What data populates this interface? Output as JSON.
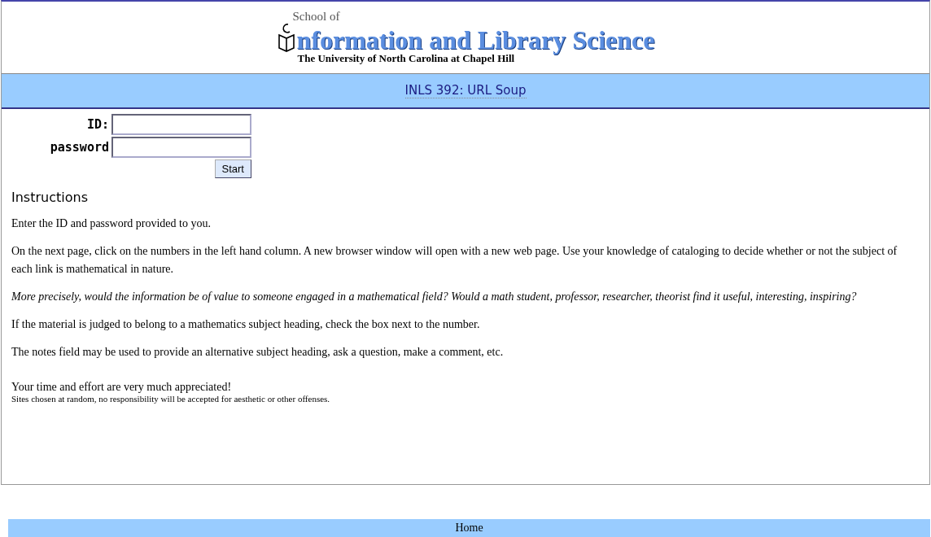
{
  "header": {
    "school_of": "School of",
    "school_name": "nformation and Library Science",
    "university": "The University of North Carolina at Chapel Hill"
  },
  "title_bar": {
    "title": "INLS 392: URL Soup"
  },
  "login": {
    "fields": [
      {
        "label": "ID:"
      },
      {
        "label": "password"
      }
    ],
    "button": "Start"
  },
  "instructions": {
    "heading": "Instructions",
    "paragraphs": [
      {
        "text": "Enter the ID and password provided to you.",
        "italic": false
      },
      {
        "text": "On the next page, click on the numbers in the left hand column. A new browser window will open with a new web page. Use your knowledge of cataloging to decide whether or not the subject of each link is mathematical in nature.",
        "italic": false
      },
      {
        "text": "More precisely, would the information be of value to someone engaged in a mathematical field? Would a math student, professor, researcher, theorist find it useful, interesting, inspiring?",
        "italic": true
      },
      {
        "text": "If the material is judged to belong to a mathematics subject heading, check the box next to the number.",
        "italic": false
      },
      {
        "text": "The notes field may be used to provide an alternative subject heading, ask a question, make a comment, etc.",
        "italic": false
      }
    ],
    "thanks": "Your time and effort are very much appreciated!",
    "disclaimer": "Sites chosen at random, no responsibility will be accepted for aesthetic or other offenses."
  },
  "footer": {
    "link": "Home"
  }
}
